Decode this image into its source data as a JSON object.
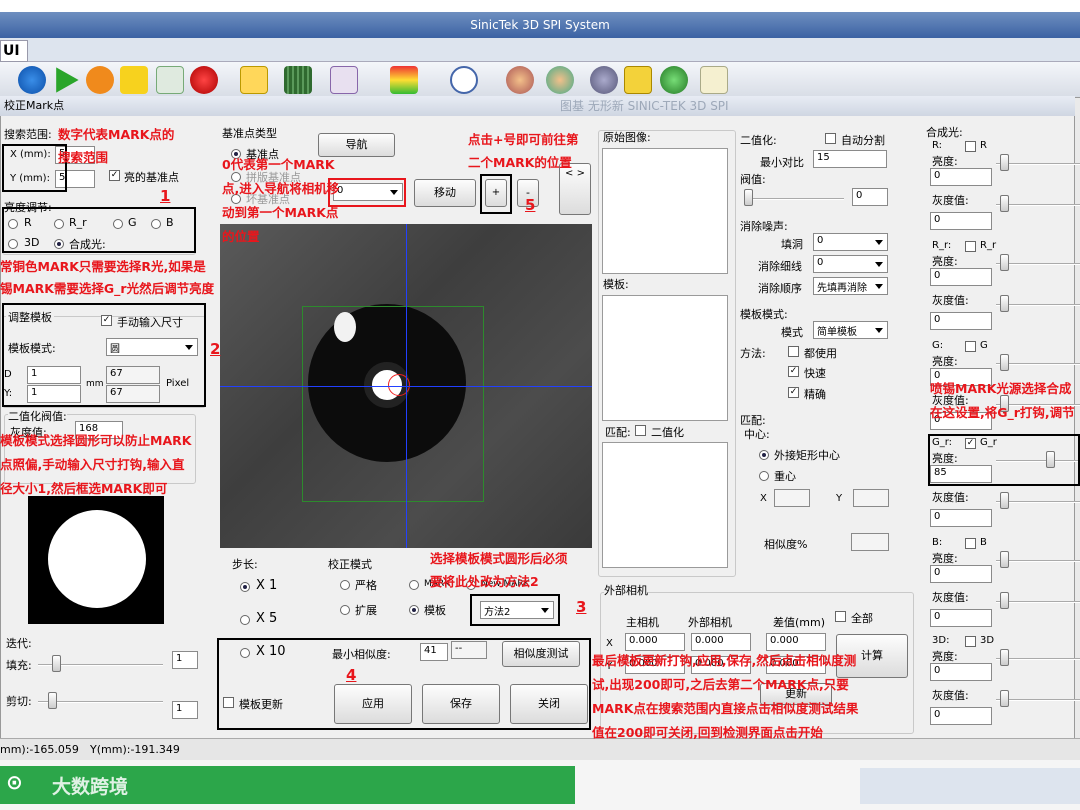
{
  "window": {
    "title": "SinicTek 3D SPI System",
    "menu_tab": "UI",
    "dialog_title": "校正Mark点",
    "ghost_text": "图基 无形新 SINIC-TEK 3D SPI"
  },
  "search": {
    "title": "搜索范围:",
    "x_label": "X (mm):",
    "x_value": "5",
    "y_label": "Y (mm):",
    "y_value": "5",
    "bright_label": "亮的基准点"
  },
  "brightness": {
    "title": "亮度调节:",
    "options": [
      "R",
      "R_r",
      "G",
      "B",
      "3D",
      "合成光:"
    ]
  },
  "template": {
    "title": "调整模板",
    "manual_label": "手动输入尺寸",
    "mode_label": "模板模式:",
    "mode_value": "圆",
    "d_label": "D",
    "y_label": "Y:",
    "d_value": "1",
    "y_value": "1",
    "mm": "mm",
    "px_d": "67",
    "px_y": "67",
    "pixel": "Pixel"
  },
  "binarize": {
    "title": "二值化阀值:",
    "gray_label": "灰度值:",
    "gray_value": "168"
  },
  "iterate": {
    "title": "迭代:",
    "fill_label": "填充:",
    "fill_value": "1",
    "cut_label": "剪切:",
    "cut_value": "1"
  },
  "ref": {
    "title": "基准点类型",
    "options": [
      "基准点",
      "拼版基准点",
      "坏基准点"
    ],
    "nav_btn": "导航",
    "select_value": "0",
    "move_btn": "移动",
    "plus_btn": "+",
    "minus_btn": "-",
    "arrows": "< >"
  },
  "step": {
    "title": "步长:",
    "options": [
      "X 1",
      "X 5",
      "X 10"
    ]
  },
  "mode": {
    "title": "校正模式",
    "options": [
      "严格",
      "MARK",
      "New MARK",
      "扩展",
      "模板"
    ],
    "method_value": "方法2"
  },
  "bottom": {
    "min_sim_label": "最小相似度:",
    "min_sim_value": "41",
    "min_sim_extra": "--",
    "test_btn": "相似度测试",
    "update_label": "模板更新",
    "apply_btn": "应用",
    "save_btn": "保存",
    "close_btn": "关闭"
  },
  "original": {
    "label": "原始图像:",
    "template_label": "模板:",
    "match_label": "匹配:",
    "binarize_label": "二值化"
  },
  "bin": {
    "title": "二值化:",
    "auto_label": "自动分割",
    "min_contrast": "最小对比",
    "min_contrast_value": "15",
    "threshold": "阀值:",
    "threshold_value": "0"
  },
  "noise": {
    "title": "消除噪声:",
    "fill": "填洞",
    "fill_value": "0",
    "thin": "消除细线",
    "thin_value": "0",
    "order": "消除顺序",
    "order_value": "先填再消除"
  },
  "tmode": {
    "title": "模板模式:",
    "mode_label": "模式",
    "mode_value": "简单模板"
  },
  "method": {
    "title": "方法:",
    "all": "都使用",
    "fast": "快速",
    "precise": "精确"
  },
  "match": {
    "title": "匹配:",
    "center": "中心:",
    "opt1": "外接矩形中心",
    "opt2": "重心",
    "x": "X",
    "y": "Y",
    "similarity": "相似度%"
  },
  "ext": {
    "title": "外部相机",
    "main": "主相机",
    "external": "外部相机",
    "diff": "差值(mm)",
    "all": "全部",
    "x": "X",
    "y": "Y",
    "v1": "0.000",
    "v2": "0.000",
    "v3": "0.000",
    "v4": "0.000",
    "v5": "0.000",
    "v6": "0.000",
    "calc": "计算",
    "update": "更新"
  },
  "synth": {
    "title": "合成光:",
    "channels": [
      {
        "id": "R:",
        "chk": "R",
        "bright": "亮度:",
        "bv": "0",
        "gray": "灰度值:",
        "gv": "0",
        "checked": false
      },
      {
        "id": "R_r:",
        "chk": "R_r",
        "bright": "亮度:",
        "bv": "0",
        "gray": "灰度值:",
        "gv": "0",
        "checked": false
      },
      {
        "id": "G:",
        "chk": "G",
        "bright": "亮度:",
        "bv": "0",
        "gray": "灰度值:",
        "gv": "0",
        "checked": false
      },
      {
        "id": "G_r:",
        "chk": "G_r",
        "bright": "亮度:",
        "bv": "85",
        "gray": "灰度值:",
        "gv": "0",
        "checked": true
      },
      {
        "id": "B:",
        "chk": "B",
        "bright": "亮度:",
        "bv": "0",
        "gray": "灰度值:",
        "gv": "0",
        "checked": false
      },
      {
        "id": "3D:",
        "chk": "3D",
        "bright": "亮度:",
        "bv": "0",
        "gray": "灰度值:",
        "gv": "0",
        "checked": false
      }
    ]
  },
  "status": {
    "x": "mm):-165.059",
    "y": "Y(mm):-191.349"
  },
  "watermark": "大数跨境",
  "notes": {
    "n1a": "数字代表MARK点的",
    "n1b": "搜索范围",
    "n_bright1": "常铜色MARK只需要选择R光,如果是",
    "n_bright2": "锡MARK需要选择G_r光然后调节亮度",
    "n_tmp1": "模板模式选择圆形可以防止MARK",
    "n_tmp2": "点照偏,手动输入尺寸打钩,输入直",
    "n_tmp3": "径大小1,然后框选MARK即可",
    "n_nav1": "0代表第一个MARK",
    "n_nav2": "点,进入导航将相机移",
    "n_nav3": "动到第一个MARK点",
    "n_nav4": "的位置",
    "n_plus1": "点击+号即可前往第",
    "n_plus2": "二个MARK的位置",
    "n_mode1": "选择模板模式圆形后必须",
    "n_mode2": "要将此处改为方法2",
    "n_right1": "喷锡MARK光源选择合成",
    "n_right2": "在这设置,将G_r打钩,调节",
    "n_bot1": "最后模板更新打钩,应用,保存,然后点击相似度测",
    "n_bot2": "试,出现200即可,之后去第二个MARK点,只要",
    "n_bot3": "MARK点在搜索范围内直接点击相似度测试结果",
    "n_bot4": "值在200即可关闭,回到检测界面点击开始",
    "num1": "1",
    "num2": "2",
    "num3": "3",
    "num4": "4",
    "num5": "5"
  }
}
